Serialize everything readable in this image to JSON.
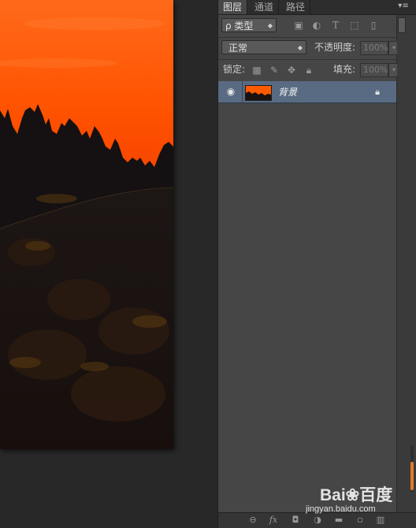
{
  "panel": {
    "tabs": [
      {
        "label": "图层",
        "active": true
      },
      {
        "label": "通道",
        "active": false
      },
      {
        "label": "路径",
        "active": false
      }
    ],
    "menu_icon": "panel-menu-icon"
  },
  "filter": {
    "kind_label": "ρ 类型",
    "icons": [
      "image-filter-icon",
      "adjustment-filter-icon",
      "type-filter-icon",
      "shape-filter-icon",
      "smart-object-filter-icon"
    ]
  },
  "blend": {
    "mode": "正常",
    "opacity_label": "不透明度:",
    "opacity_value": "100%"
  },
  "lock": {
    "label": "锁定:",
    "fill_label": "填充:",
    "fill_value": "100%"
  },
  "layers": [
    {
      "name": "背景",
      "visible": true,
      "locked": true,
      "selected": true
    }
  ],
  "bottom_icons": [
    "link-icon",
    "fx-icon",
    "mask-icon",
    "adjustment-icon",
    "group-folder-icon",
    "new-layer-icon",
    "trash-icon"
  ],
  "watermark": {
    "logo": "Bai❀百度",
    "site": "jingyan.baidu.com"
  },
  "colors": {
    "panel_bg": "#464646",
    "selected_layer": "#596b82",
    "scroll_accent": "#e07b2a",
    "sky_orange": "#ff5a00"
  }
}
